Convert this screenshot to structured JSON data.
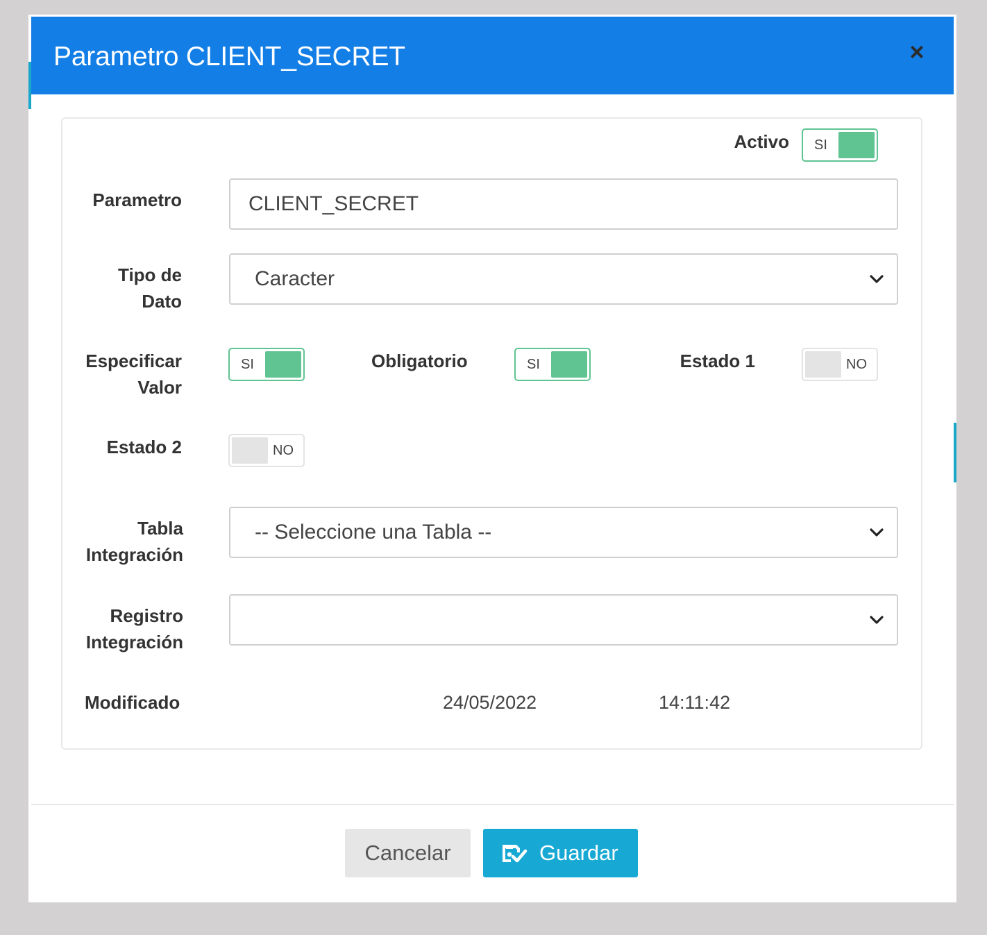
{
  "modal": {
    "title": "Parametro CLIENT_SECRET",
    "close_glyph": "×"
  },
  "form": {
    "activo": {
      "label": "Activo",
      "state": "SI"
    },
    "parametro": {
      "label": "Parametro",
      "value": "CLIENT_SECRET"
    },
    "tipo_dato": {
      "label_line1": "Tipo de",
      "label_line2": "Dato",
      "selected": "Caracter"
    },
    "especificar_valor": {
      "label_line1": "Especificar",
      "label_line2": "Valor",
      "state": "SI"
    },
    "obligatorio": {
      "label": "Obligatorio",
      "state": "SI"
    },
    "estado1": {
      "label": "Estado 1",
      "state": "NO"
    },
    "estado2": {
      "label": "Estado 2",
      "state": "NO"
    },
    "tabla_integracion": {
      "label_line1": "Tabla",
      "label_line2": "Integración",
      "selected": "-- Seleccione una Tabla --"
    },
    "registro_integracion": {
      "label_line1": "Registro",
      "label_line2": "Integración",
      "selected": ""
    },
    "modificado": {
      "label": "Modificado",
      "date": "24/05/2022",
      "time": "14:11:42"
    }
  },
  "footer": {
    "cancel_label": "Cancelar",
    "save_label": "Guardar",
    "save_icon": "save-check-icon"
  },
  "colors": {
    "header": "#137ee6",
    "toggle_on": "#5fc491",
    "toggle_off": "#e4e4e4",
    "save_button": "#17a8d4",
    "cancel_button": "#e6e6e6"
  }
}
